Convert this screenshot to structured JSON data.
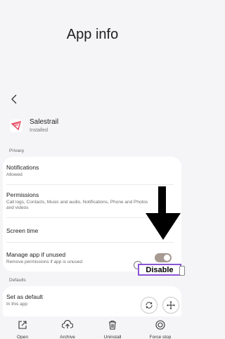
{
  "page": {
    "title": "App info"
  },
  "app": {
    "name": "Salestrail",
    "status": "Installed",
    "accent": "#e23a55"
  },
  "sections": {
    "privacy": "Privacy",
    "defaults": "Defaults"
  },
  "privacy_items": [
    {
      "title": "Notifications",
      "subtitle": "Allowed"
    },
    {
      "title": "Permissions",
      "subtitle": "Call logs, Contacts, Music and audio, Notifications, Phone and Photos and videos"
    },
    {
      "title": "Screen time",
      "subtitle": ""
    },
    {
      "title": "Manage app if unused",
      "subtitle": "Remove permissions if app is unused",
      "toggle_on": true
    }
  ],
  "defaults_items": [
    {
      "title": "Set as default",
      "subtitle": "In this app"
    }
  ],
  "overlay": {
    "disable_label": "Disable",
    "border_color": "#8a55d6"
  },
  "bottom_actions": [
    {
      "label": "Open",
      "icon": "open-icon"
    },
    {
      "label": "Archive",
      "icon": "archive-icon"
    },
    {
      "label": "Uninstall",
      "icon": "trash-icon"
    },
    {
      "label": "Force stop",
      "icon": "stop-icon"
    }
  ]
}
